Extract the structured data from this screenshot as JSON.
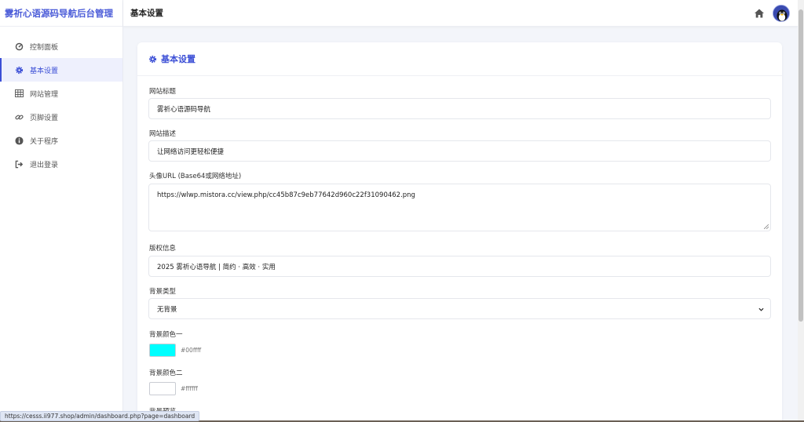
{
  "sidebar": {
    "brand": "雾祈心语源码导航后台管理",
    "items": [
      {
        "label": "控制面板",
        "icon": "dashboard-icon"
      },
      {
        "label": "基本设置",
        "icon": "gear-icon"
      },
      {
        "label": "网站管理",
        "icon": "table-icon"
      },
      {
        "label": "页脚设置",
        "icon": "link-icon"
      },
      {
        "label": "关于程序",
        "icon": "info-icon"
      },
      {
        "label": "退出登录",
        "icon": "logout-icon"
      }
    ],
    "active_item": "基本设置"
  },
  "header": {
    "title": "基本设置",
    "home_icon": "home-icon",
    "avatar_icon": "penguin-avatar-icon"
  },
  "card": {
    "title": "基本设置",
    "icon": "gear-icon"
  },
  "form": {
    "site_title": {
      "label": "网站标题",
      "value": "雾祈心语源码导航"
    },
    "site_description": {
      "label": "网站描述",
      "value": "让网络访问更轻松便捷"
    },
    "avatar_url": {
      "label": "头像URL (Base64或网络地址)",
      "value": "https://wlwp.mistora.cc/view.php/cc45b87c9eb77642d960c22f31090462.png"
    },
    "copyright": {
      "label": "版权信息",
      "value": "2025 雾祈心语导航 | 简约 · 高效 · 实用"
    },
    "background_type": {
      "label": "背景类型",
      "value": "无背景"
    },
    "bg_color_1": {
      "label": "背景颜色一",
      "value": "#00ffff"
    },
    "bg_color_2": {
      "label": "背景颜色二",
      "value": "#ffffff"
    },
    "bg_preview": {
      "label": "背景预览"
    }
  },
  "statusbar": {
    "url": "https://cesss.ii977.shop/admin/dashboard.php?page=dashboard"
  },
  "colors": {
    "accent": "#3c4fd6",
    "active_bg": "#eef0fd",
    "page_bg": "#f3f5fa"
  }
}
